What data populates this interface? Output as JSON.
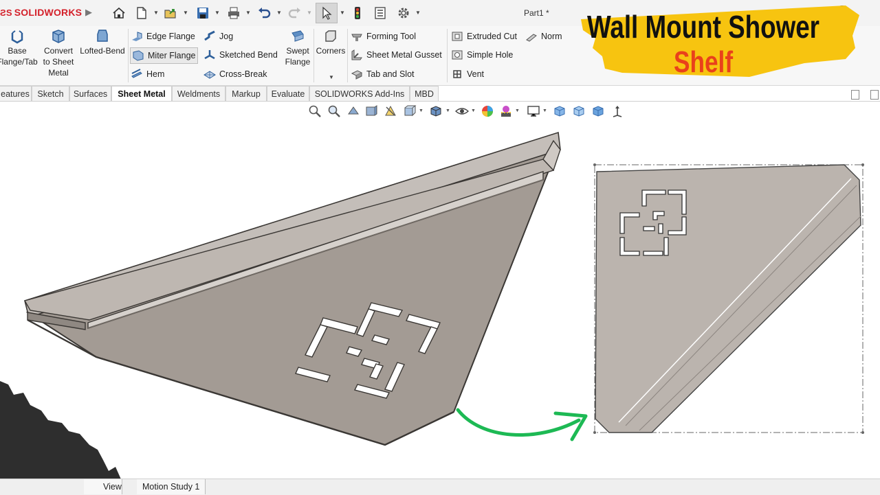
{
  "app": {
    "logo_text": "SOLIDWORKS",
    "document_title": "Part1 *"
  },
  "colors": {
    "brand_red": "#d4202a",
    "banner_yellow": "#f7c410",
    "subtitle_orange": "#e9411b",
    "part_gray": "#a39b94",
    "flat_gray": "#bbb4ae",
    "arrow_green": "#1db954"
  },
  "quick_access": [
    "home-icon",
    "new-document-icon",
    "open-icon",
    "save-icon",
    "print-icon",
    "undo-icon",
    "redo-icon",
    "select-icon",
    "rebuild-icon",
    "file-properties-icon",
    "options-icon"
  ],
  "ribbon": {
    "base_flange": "Base\nFlange/Tab",
    "convert": "Convert\nto Sheet\nMetal",
    "lofted_bend": "Lofted-Bend",
    "edge_flange": "Edge Flange",
    "miter_flange": "Miter Flange",
    "hem": "Hem",
    "jog": "Jog",
    "sketched_bend": "Sketched Bend",
    "cross_break": "Cross-Break",
    "swept_flange": "Swept\nFlange",
    "corners": "Corners",
    "forming_tool": "Forming Tool",
    "gusset": "Sheet Metal Gusset",
    "tab_slot": "Tab and Slot",
    "extruded_cut": "Extruded Cut",
    "simple_hole": "Simple Hole",
    "vent": "Vent",
    "normal_cut": "Norm"
  },
  "tabs": [
    "eatures",
    "Sketch",
    "Surfaces",
    "Sheet Metal",
    "Weldments",
    "Markup",
    "Evaluate",
    "SOLIDWORKS Add-Ins",
    "MBD"
  ],
  "active_tab": "Sheet Metal",
  "bottom_tabs": [
    "View",
    "Motion Study 1"
  ],
  "overlay": {
    "title_line1": "Wall Mount Shower",
    "title_line2": "Shelf"
  }
}
